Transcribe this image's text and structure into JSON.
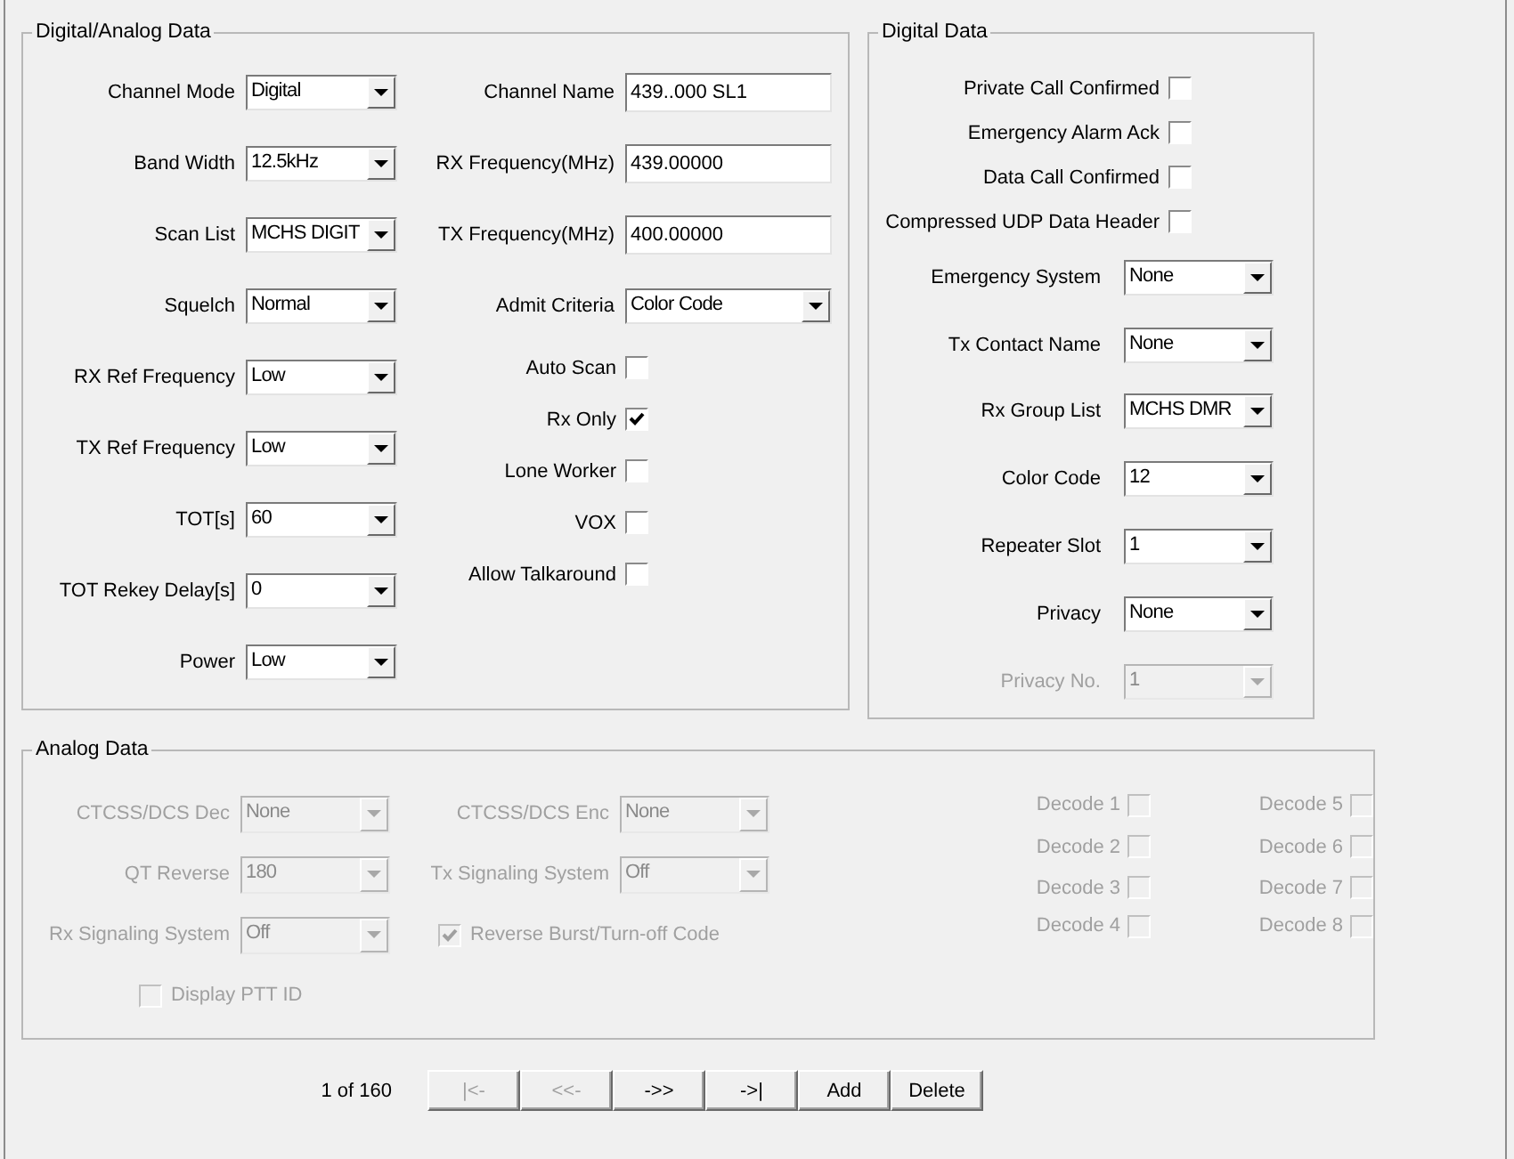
{
  "digital_analog_data": {
    "title": "Digital/Analog Data",
    "left_fields": [
      {
        "label": "Channel Mode",
        "kind": "combo",
        "value": "Digital"
      },
      {
        "label": "Band Width",
        "kind": "combo",
        "value": "12.5kHz"
      },
      {
        "label": "Scan List",
        "kind": "combo",
        "value": "MCHS DIGIT"
      },
      {
        "label": "Squelch",
        "kind": "combo",
        "value": "Normal"
      },
      {
        "label": "RX Ref Frequency",
        "kind": "combo",
        "value": "Low"
      },
      {
        "label": "TX Ref Frequency",
        "kind": "combo",
        "value": "Low"
      },
      {
        "label": "TOT[s]",
        "kind": "combo",
        "value": "60"
      },
      {
        "label": "TOT Rekey Delay[s]",
        "kind": "combo",
        "value": "0"
      },
      {
        "label": "Power",
        "kind": "combo",
        "value": "Low"
      }
    ],
    "right_fields": [
      {
        "label": "Channel Name",
        "kind": "text",
        "value": "439..000 SL1"
      },
      {
        "label": "RX Frequency(MHz)",
        "kind": "text",
        "value": "439.00000"
      },
      {
        "label": "TX Frequency(MHz)",
        "kind": "text",
        "value": "400.00000"
      },
      {
        "label": "Admit Criteria",
        "kind": "combo",
        "value": "Color Code"
      },
      {
        "label": "Auto Scan",
        "kind": "checkbox",
        "checked": false
      },
      {
        "label": "Rx Only",
        "kind": "checkbox",
        "checked": true
      },
      {
        "label": "Lone Worker",
        "kind": "checkbox",
        "checked": false
      },
      {
        "label": "VOX",
        "kind": "checkbox",
        "checked": false
      },
      {
        "label": "Allow Talkaround",
        "kind": "checkbox",
        "checked": false
      }
    ]
  },
  "digital_data": {
    "title": "Digital Data",
    "fields": [
      {
        "label": "Private Call Confirmed",
        "kind": "checkbox",
        "checked": false,
        "disabled": false
      },
      {
        "label": "Emergency Alarm Ack",
        "kind": "checkbox",
        "checked": false,
        "disabled": false
      },
      {
        "label": "Data Call Confirmed",
        "kind": "checkbox",
        "checked": false,
        "disabled": false
      },
      {
        "label": "Compressed UDP Data Header",
        "kind": "checkbox",
        "checked": false,
        "disabled": false
      },
      {
        "label": "Emergency System",
        "kind": "combo",
        "value": "None",
        "disabled": false
      },
      {
        "label": "Tx Contact Name",
        "kind": "combo",
        "value": "None",
        "disabled": false
      },
      {
        "label": "Rx Group List",
        "kind": "combo",
        "value": "MCHS DMR",
        "disabled": false
      },
      {
        "label": "Color Code",
        "kind": "combo",
        "value": "12",
        "disabled": false
      },
      {
        "label": "Repeater Slot",
        "kind": "combo",
        "value": "1",
        "disabled": false
      },
      {
        "label": "Privacy",
        "kind": "combo",
        "value": "None",
        "disabled": false
      },
      {
        "label": "Privacy No.",
        "kind": "combo",
        "value": "1",
        "disabled": true
      }
    ]
  },
  "analog_data": {
    "title": "Analog Data",
    "disabled": true,
    "fields": [
      {
        "label": "CTCSS/DCS Dec",
        "kind": "combo",
        "value": "None"
      },
      {
        "label": "CTCSS/DCS Enc",
        "kind": "combo",
        "value": "None"
      },
      {
        "label": "QT Reverse",
        "kind": "combo",
        "value": "180"
      },
      {
        "label": "Tx Signaling System",
        "kind": "combo",
        "value": "Off"
      },
      {
        "label": "Rx Signaling System",
        "kind": "combo",
        "value": "Off"
      },
      {
        "label": "Reverse Burst/Turn-off Code",
        "kind": "checkbox",
        "checked": true
      },
      {
        "label": "Display PTT ID",
        "kind": "checkbox",
        "checked": false
      }
    ],
    "decodes": [
      {
        "label": "Decode 1",
        "checked": false
      },
      {
        "label": "Decode 2",
        "checked": false
      },
      {
        "label": "Decode 3",
        "checked": false
      },
      {
        "label": "Decode 4",
        "checked": false
      },
      {
        "label": "Decode 5",
        "checked": false
      },
      {
        "label": "Decode 6",
        "checked": false
      },
      {
        "label": "Decode 7",
        "checked": false
      },
      {
        "label": "Decode 8",
        "checked": false
      }
    ]
  },
  "navigator": {
    "position": "1 of 160",
    "buttons": [
      {
        "label": "|<-",
        "disabled": true
      },
      {
        "label": "<<-",
        "disabled": true
      },
      {
        "label": "->>",
        "disabled": false
      },
      {
        "label": "->|",
        "disabled": false
      },
      {
        "label": "Add",
        "disabled": false
      },
      {
        "label": "Delete",
        "disabled": false
      }
    ]
  }
}
